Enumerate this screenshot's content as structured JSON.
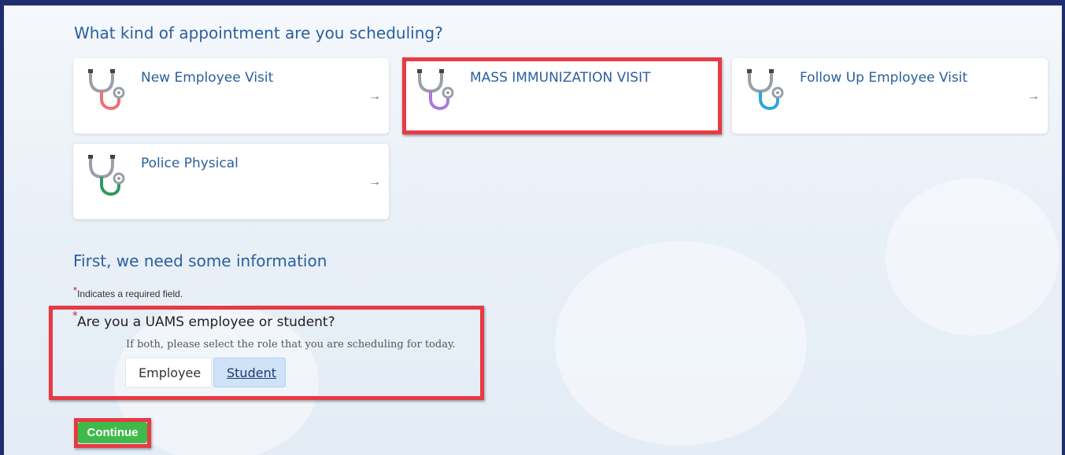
{
  "section1": {
    "heading": "What kind of appointment are you scheduling?"
  },
  "appointments": [
    {
      "label": "New Employee Visit",
      "icon": "stethoscope-icon",
      "tube_color": "#f07070",
      "arrow": "→"
    },
    {
      "label": "MASS IMMUNIZATION VISIT",
      "icon": "stethoscope-icon",
      "tube_color": "#a97ad9",
      "arrow": ""
    },
    {
      "label": "Follow Up Employee Visit",
      "icon": "stethoscope-icon",
      "tube_color": "#2fa4dc",
      "arrow": "→"
    },
    {
      "label": "Police Physical",
      "icon": "stethoscope-icon",
      "tube_color": "#2e9a60",
      "arrow": "→"
    }
  ],
  "section2": {
    "heading": "First, we need some information",
    "required_note": "Indicates a required field.",
    "required_mark": "*",
    "question": "Are you a UAMS employee or student?",
    "hint": "If both, please select the role that you are scheduling for today.",
    "options": [
      {
        "label": "Employee",
        "selected": false
      },
      {
        "label": "Student",
        "selected": true
      }
    ]
  },
  "actions": {
    "continue_label": "Continue"
  },
  "colors": {
    "frame": "#1f2d6e",
    "link": "#2a5f9e",
    "highlight": "#e63b44",
    "continue_bg": "#3fba4a",
    "selected_bg": "#cfe2f7"
  }
}
